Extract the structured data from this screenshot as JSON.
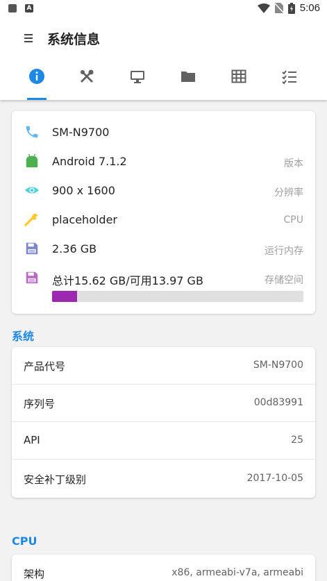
{
  "status_bar": {
    "time": "5:06",
    "left_icons": [
      "grid-icon",
      "a-icon"
    ],
    "a_glyph": "A"
  },
  "app_bar": {
    "title": "系统信息"
  },
  "tabs": [
    {
      "name": "info",
      "icon": "info-icon",
      "selected": true
    },
    {
      "name": "tools",
      "icon": "tools-icon",
      "selected": false
    },
    {
      "name": "display",
      "icon": "monitor-icon",
      "selected": false
    },
    {
      "name": "storage",
      "icon": "folder-icon",
      "selected": false
    },
    {
      "name": "apps",
      "icon": "grid-table-icon",
      "selected": false
    },
    {
      "name": "checklist",
      "icon": "checklist-icon",
      "selected": false
    }
  ],
  "overview": {
    "rows": [
      {
        "icon": "phone-icon",
        "value": "SM-N9700",
        "label": ""
      },
      {
        "icon": "android-icon",
        "value": "Android 7.1.2",
        "label": "版本"
      },
      {
        "icon": "eye-icon",
        "value": "900 x 1600",
        "label": "分辨率"
      },
      {
        "icon": "wrench-icon",
        "value": "placeholder",
        "label": "CPU"
      },
      {
        "icon": "save-icon",
        "value": "2.36 GB",
        "label": "运行内存"
      },
      {
        "icon": "storage-icon",
        "value": "总计15.62 GB/可用13.97 GB",
        "label": "存储空间"
      }
    ],
    "storage_used_fraction": 0.1,
    "colors": {
      "phone": "#64b5f6",
      "android": "#4caf50",
      "eye": "#4dd0e1",
      "wrench": "#ffca28",
      "ram": "#7986cb",
      "storage": "#ba68c8",
      "progress": "#9c27b0"
    }
  },
  "system_section": {
    "title": "系统",
    "rows": [
      {
        "key": "产品代号",
        "value": "SM-N9700"
      },
      {
        "key": "序列号",
        "value": "00d83991"
      },
      {
        "key": "API",
        "value": "25"
      },
      {
        "key": "安全补丁级别",
        "value": "2017-10-05"
      }
    ]
  },
  "cpu_section": {
    "title": "CPU",
    "rows": [
      {
        "key": "架构",
        "value": "x86, armeabi-v7a, armeabi"
      }
    ]
  },
  "accent_color": "#1e88e5"
}
